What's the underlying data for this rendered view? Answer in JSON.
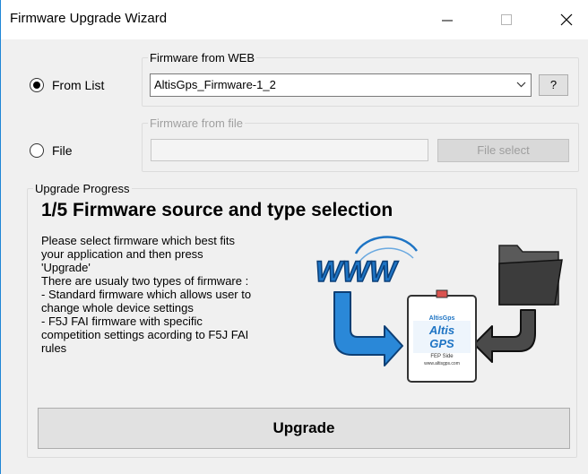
{
  "window": {
    "title": "Firmware Upgrade Wizard",
    "controls": {
      "minimize": "—",
      "maximize": "☐",
      "close": "✕"
    }
  },
  "source": {
    "from_list_label": "From List",
    "from_list_selected": true,
    "file_label": "File",
    "file_selected": false
  },
  "web_group": {
    "legend": "Firmware from WEB",
    "selected_firmware": "AltisGps_Firmware-1_2",
    "help_label": "?"
  },
  "file_group": {
    "legend": "Firmware from file",
    "path_value": "",
    "select_label": "File select"
  },
  "progress": {
    "legend": "Upgrade Progress",
    "heading": "1/5 Firmware source and type selection",
    "description": [
      "Please select firmware which best fits",
      "your application and then press",
      "'Upgrade'",
      "There are usualy two types of firmware :",
      "- Standard firmware which allows user to",
      "change whole device settings",
      "- F5J FAI firmware with specific",
      "competition settings acording to F5J FAI",
      "rules"
    ]
  },
  "illustration": {
    "www_text": "WWW",
    "device_brand": "AltisGps",
    "device_line1": "Altis",
    "device_line2": "GPS",
    "device_line3": "FEP Side",
    "device_footer": "www.altisgps.com",
    "icons": [
      "www-icon",
      "folder-icon",
      "device-icon",
      "arrow-down-right-icon",
      "arrow-down-left-icon"
    ]
  },
  "upgrade_label": "Upgrade",
  "colors": {
    "accent": "#1f86d6",
    "window_bg": "#f0f0f0",
    "www_blue": "#1e74c4",
    "arrow_blue": "#2a88d8",
    "folder_dark": "#3c3c3c"
  }
}
